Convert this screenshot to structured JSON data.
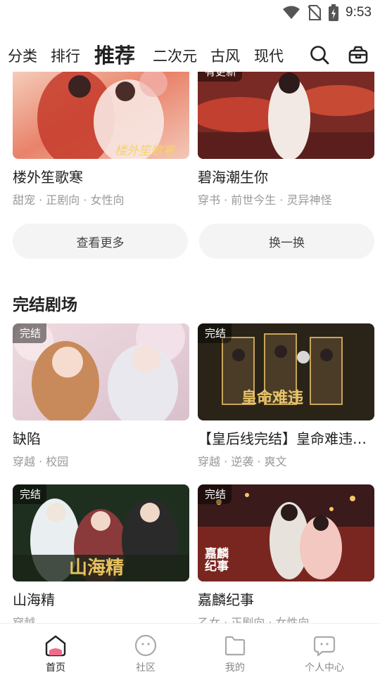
{
  "status": {
    "time": "9:53"
  },
  "nav": {
    "tabs": [
      "分类",
      "排行",
      "推荐",
      "二次元",
      "古风",
      "现代"
    ],
    "active_tab": "推荐"
  },
  "top_cards": [
    {
      "title": "楼外笙歌寒",
      "tags": "甜宠 · 正剧向 · 女性向",
      "cover_text": "楼外笙歌寒"
    },
    {
      "title": "碧海潮生你",
      "tags": "穿书 · 前世今生 · 灵异神怪",
      "badge": "有更新"
    }
  ],
  "buttons": {
    "see_more": "查看更多",
    "refresh": "换一换"
  },
  "section": {
    "title": "完结剧场"
  },
  "finished_cards": [
    {
      "badge": "完结",
      "title": "缺陷",
      "tags": "穿越 · 校园"
    },
    {
      "badge": "完结",
      "title": "【皇后线完结】皇命难违…",
      "tags": "穿越 · 逆袭 · 爽文",
      "cover_text": "皇命难违"
    },
    {
      "badge": "完结",
      "title": "山海精",
      "tags": "穿越",
      "cover_text": "山海精"
    },
    {
      "badge": "完结",
      "title": "嘉麟纪事",
      "tags": "乙女 · 正剧向 · 女性向",
      "cover_text": "嘉麟纪事"
    }
  ],
  "bottom_nav": [
    {
      "label": "首页",
      "icon": "home-icon",
      "active": true
    },
    {
      "label": "社区",
      "icon": "community-icon"
    },
    {
      "label": "我的",
      "icon": "folder-icon"
    },
    {
      "label": "个人中心",
      "icon": "profile-icon"
    }
  ],
  "colors": {
    "accent_pink": "#f06a8a",
    "pill_bg": "#f4f4f4",
    "tag_gray": "#999999"
  }
}
